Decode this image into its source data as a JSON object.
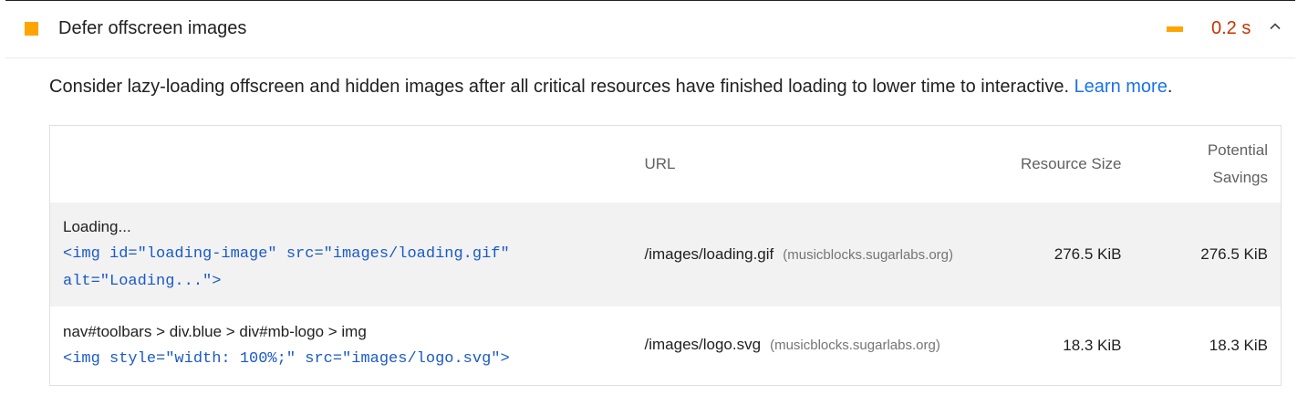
{
  "audit": {
    "title": "Defer offscreen images",
    "savings": "0.2 s",
    "status_color": "#ffa400",
    "savings_color": "#c33300",
    "expanded_icon": "chevron-up-icon"
  },
  "description": {
    "text": "Consider lazy-loading offscreen and hidden images after all critical resources have finished loading to lower time to interactive. ",
    "link_label": "Learn more",
    "suffix": "."
  },
  "table": {
    "headers": {
      "node": "",
      "url": "URL",
      "resource_size": "Resource Size",
      "potential_savings": "Potential Savings"
    },
    "rows": [
      {
        "node_label": "Loading...",
        "snippet": "<img id=\"loading-image\" src=\"images/loading.gif\" alt=\"Loading...\">",
        "url": "/images/loading.gif",
        "host": "(musicblocks.sugarlabs.org)",
        "resource_size": "276.5 KiB",
        "potential_savings": "276.5 KiB"
      },
      {
        "node_label": "nav#toolbars > div.blue > div#mb-logo > img",
        "snippet": "<img style=\"width: 100%;\" src=\"images/logo.svg\">",
        "url": "/images/logo.svg",
        "host": "(musicblocks.sugarlabs.org)",
        "resource_size": "18.3 KiB",
        "potential_savings": "18.3 KiB"
      }
    ]
  }
}
